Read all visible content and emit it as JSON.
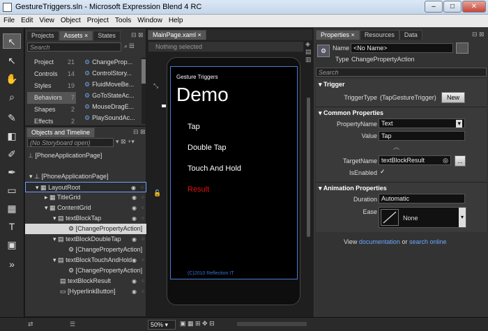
{
  "window": {
    "title": "GestureTriggers.sln - Microsoft Expression Blend 4 RC",
    "minimize": "–",
    "maximize": "□",
    "close": "✕"
  },
  "menu": [
    "File",
    "Edit",
    "View",
    "Object",
    "Project",
    "Tools",
    "Window",
    "Help"
  ],
  "left_tabs": {
    "projects": "Projects",
    "assets": "Assets",
    "assets_close": "×",
    "states": "States"
  },
  "assets": {
    "search_placeholder": "Search",
    "categories": [
      {
        "label": "Project",
        "count": "21"
      },
      {
        "label": "Controls",
        "count": "14"
      },
      {
        "label": "Styles",
        "count": "19"
      },
      {
        "label": "Behaviors",
        "count": "7"
      },
      {
        "label": "Shapes",
        "count": "2"
      },
      {
        "label": "Effects",
        "count": "2"
      }
    ],
    "behaviors": [
      "ChangeProp...",
      "ControlStory...",
      "FluidMoveBe...",
      "GoToStateAc...",
      "MouseDragE...",
      "PlaySoundAc..."
    ]
  },
  "objects": {
    "tab": "Objects and Timeline",
    "storyboard": "(No Storyboard open)",
    "root_page": "[PhoneApplicationPage]",
    "items": [
      {
        "label": "[PhoneApplicationPage]"
      },
      {
        "label": "LayoutRoot"
      },
      {
        "label": "TitleGrid"
      },
      {
        "label": "ContentGrid"
      },
      {
        "label": "textBlockTap"
      },
      {
        "label": "[ChangePropertyAction]"
      },
      {
        "label": "textBlockDoubleTap"
      },
      {
        "label": "[ChangePropertyAction]"
      },
      {
        "label": "textBlockTouchAndHold"
      },
      {
        "label": "[ChangePropertyAction]"
      },
      {
        "label": "textBlockResult"
      },
      {
        "label": "[HyperlinkButton]"
      }
    ]
  },
  "document": {
    "tab": "MainPage.xaml",
    "tab_close": "×",
    "selection": "Nothing selected",
    "zoom": "50%"
  },
  "phone": {
    "app_title": "Gesture Triggers",
    "page_title": "Demo",
    "items": [
      "Tap",
      "Double Tap",
      "Touch And Hold"
    ],
    "result": "Result",
    "footer": "(C)2010 Reflection IT",
    "result_color": "#e01010",
    "accent_color": "#3a70d0"
  },
  "properties": {
    "tabs": [
      "Properties",
      "Resources",
      "Data"
    ],
    "tab_close": "×",
    "name_label": "Name",
    "name_value": "<No Name>",
    "type_label": "Type",
    "type_value": "ChangePropertyAction",
    "search_placeholder": "Search",
    "trigger_section": "Trigger",
    "trigger_type_label": "TriggerType",
    "trigger_type_value": "(TapGestureTrigger)",
    "new_button": "New",
    "common_section": "Common Properties",
    "property_name_label": "PropertyName",
    "property_name_value": "Text",
    "value_label": "Value",
    "value_value": "Tap",
    "target_name_label": "TargetName",
    "target_name_value": "textBlockResult",
    "ellipsis": "...",
    "is_enabled_label": "IsEnabled",
    "is_enabled_checked": "✓",
    "animation_section": "Animation Properties",
    "duration_label": "Duration",
    "duration_value": "Automatic",
    "ease_label": "Ease",
    "ease_value": "None",
    "footer_view": "View",
    "footer_documentation": "documentation",
    "footer_or": "or",
    "footer_search_online": "search online"
  }
}
